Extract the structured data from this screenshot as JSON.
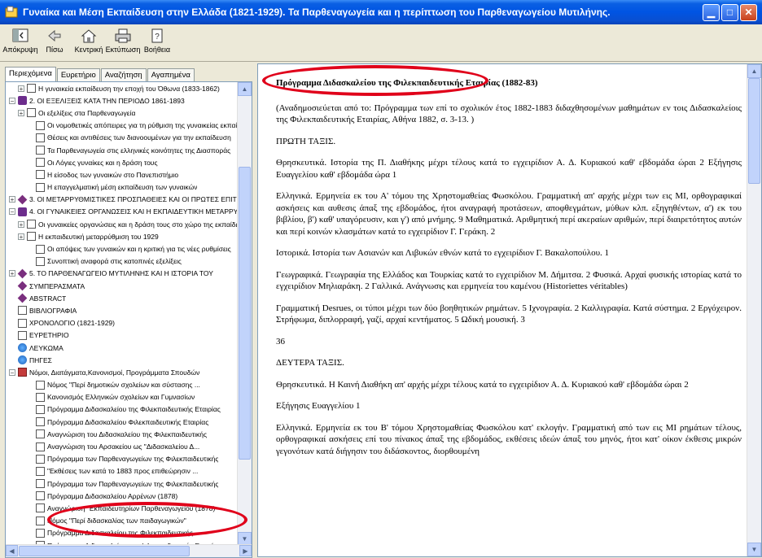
{
  "window": {
    "title": "Γυναίκα και Μέση Εκπαίδευση στην Ελλάδα (1821-1929). Τα Παρθεναγωγεία και η περίπτωση του Παρθεναγωγείου Μυτιλήνης.",
    "minimize": "▁",
    "maximize": "□",
    "close": "✕"
  },
  "toolbar": {
    "hide": "Απόκρυψη",
    "back": "Πίσω",
    "home": "Κεντρική",
    "print": "Εκτύπωση",
    "help": "Βοήθεια"
  },
  "tabs": [
    {
      "label": "Περιεχόμενα",
      "active": true
    },
    {
      "label": "Ευρετήριο",
      "active": false
    },
    {
      "label": "Αναζήτηση",
      "active": false
    },
    {
      "label": "Αγαπημένα",
      "active": false
    }
  ],
  "tree": [
    {
      "indent": 1,
      "exp": "+",
      "icon": "page",
      "label": "Η γυναικεία εκπαίδευση την εποχή του Όθωνα (1833-1862)"
    },
    {
      "indent": 0,
      "exp": "−",
      "icon": "book",
      "label": "2. ΟΙ ΕΞΕΛΙΞΕΙΣ ΚΑΤΑ ΤΗΝ ΠΕΡΙΟΔΟ 1861-1893"
    },
    {
      "indent": 1,
      "exp": "+",
      "icon": "page",
      "label": "Οι εξελίξεις στα Παρθεναγωγεία"
    },
    {
      "indent": 2,
      "exp": "",
      "icon": "page",
      "label": "Οι νομοθετικές απόπειρες για τη ρύθμιση της γυναικείας εκπαίδευσης"
    },
    {
      "indent": 2,
      "exp": "",
      "icon": "page",
      "label": "Θέσεις και αντιθέσεις των διανοουμένων για την εκπαίδευση"
    },
    {
      "indent": 2,
      "exp": "",
      "icon": "page",
      "label": "Τα Παρθεναγωγεία στις ελληνικές κοινότητες της Διασποράς"
    },
    {
      "indent": 2,
      "exp": "",
      "icon": "page",
      "label": "Οι Λόγιες γυναίκες και η δράση τους"
    },
    {
      "indent": 2,
      "exp": "",
      "icon": "page",
      "label": "Η είσοδος των γυναικών στο Πανεπιστήμιο"
    },
    {
      "indent": 2,
      "exp": "",
      "icon": "page",
      "label": "Η επαγγελματική μέση εκπαίδευση των γυναικών"
    },
    {
      "indent": 0,
      "exp": "+",
      "icon": "gem",
      "label": "3. ΟΙ ΜΕΤΑΡΡΥΘΜΙΣΤΙΚΕΣ ΠΡΟΣΠΑΘΕΙΕΣ ΚΑΙ ΟΙ ΠΡΩΤΕΣ ΕΠΙΤΥΧΙΕΣ"
    },
    {
      "indent": 0,
      "exp": "−",
      "icon": "book",
      "label": "4. ΟΙ ΓΥΝΑΙΚΕΙΕΣ ΟΡΓΑΝΩΣΕΙΣ ΚΑΙ Η ΕΚΠΑΙΔΕΥΤΙΚΗ ΜΕΤΑΡΡΥΘΜΙΣΗ"
    },
    {
      "indent": 1,
      "exp": "+",
      "icon": "page",
      "label": "Οι γυναικείες οργανώσεις και η δράση τους στο χώρο της εκπαίδευσης"
    },
    {
      "indent": 1,
      "exp": "+",
      "icon": "page",
      "label": "Η εκπαιδευτική μεταρρύθμιση του 1929"
    },
    {
      "indent": 2,
      "exp": "",
      "icon": "page",
      "label": "Οι απόψεις των γυναικών και η κριτική για τις νέες ρυθμίσεις"
    },
    {
      "indent": 2,
      "exp": "",
      "icon": "page",
      "label": "Συνοπτική αναφορά στις κατοπινές εξελίξεις"
    },
    {
      "indent": 0,
      "exp": "+",
      "icon": "gem",
      "label": "5. ΤΟ ΠΑΡΘΕΝΑΓΩΓΕΙΟ ΜΥΤΙΛΗΝΗΣ ΚΑΙ Η ΙΣΤΟΡΙΑ ΤΟΥ"
    },
    {
      "indent": 0,
      "exp": "",
      "icon": "gem",
      "label": "ΣΥΜΠΕΡΑΣΜΑΤΑ"
    },
    {
      "indent": 0,
      "exp": "",
      "icon": "gem",
      "label": "ABSTRACT"
    },
    {
      "indent": 0,
      "exp": "",
      "icon": "page",
      "label": "ΒΙΒΛΙΟΓΡΑΦΙΑ"
    },
    {
      "indent": 0,
      "exp": "",
      "icon": "page",
      "label": "ΧΡΟΝΟΛΟΓΙΟ (1821-1929)"
    },
    {
      "indent": 0,
      "exp": "",
      "icon": "page",
      "label": "ΕΥΡΕΤΗΡΙΟ"
    },
    {
      "indent": 0,
      "exp": "",
      "icon": "globe",
      "label": "ΛΕΥΚΩΜΑ"
    },
    {
      "indent": 0,
      "exp": "",
      "icon": "globe",
      "label": "ΠΗΓΕΣ"
    },
    {
      "indent": 0,
      "exp": "−",
      "icon": "redbook",
      "label": "Νόμοι, Διατάγματα,Κανονισμοί, Προγράμματα Σπουδών"
    },
    {
      "indent": 2,
      "exp": "",
      "icon": "page",
      "label": "Νόμος \"Περί δημοτικών σχολείων και σύστασης ..."
    },
    {
      "indent": 2,
      "exp": "",
      "icon": "page",
      "label": "Κανονισμός Ελληνικών σχολείων και Γυμνασίων"
    },
    {
      "indent": 2,
      "exp": "",
      "icon": "page",
      "label": "Πρόγραμμα Διδασκαλείου της Φιλεκπαιδευτικής Εταιρίας"
    },
    {
      "indent": 2,
      "exp": "",
      "icon": "page",
      "label": "Πρόγραμμα Διδασκαλείου Φιλεκπαιδευτικής Εταιρίας"
    },
    {
      "indent": 2,
      "exp": "",
      "icon": "page",
      "label": "Αναγνώριση του Διδασκαλείου της Φιλεκπαιδευτικής"
    },
    {
      "indent": 2,
      "exp": "",
      "icon": "page",
      "label": "Αναγνώριση του Αρσακείου ως \"Διδασκαλείου Δ..."
    },
    {
      "indent": 2,
      "exp": "",
      "icon": "page",
      "label": "Πρόγραμμα των Παρθεναγωγείων της Φιλεκπαιδευτικής"
    },
    {
      "indent": 2,
      "exp": "",
      "icon": "page",
      "label": "\"Εκθέσεις των κατά το 1883 προς επιθεώρησιν ..."
    },
    {
      "indent": 2,
      "exp": "",
      "icon": "page",
      "label": "Πρόγραμμα των Παρθεναγωγείων της Φιλεκπαιδευτικής"
    },
    {
      "indent": 2,
      "exp": "",
      "icon": "page",
      "label": "Πρόγραμμα Διδασκαλείου Αρρένων (1878)"
    },
    {
      "indent": 2,
      "exp": "",
      "icon": "page",
      "label": "Αναγνώριση \"Εκπαιδευτηρίων Παρθεναγωγείου (1878)"
    },
    {
      "indent": 2,
      "exp": "",
      "icon": "page",
      "label": "Νόμος \"Περί διδασκαλίας των παιδαγωγικών\""
    },
    {
      "indent": 2,
      "exp": "",
      "icon": "page",
      "label": "Πρόγραμμα Διδασκαλείου της Φιλεκπαιδευτικής"
    },
    {
      "indent": 2,
      "exp": "",
      "icon": "page",
      "label": "Πρόγραμμα Διδασκαλείου της Φιλεκπαιδευτικής Εταιρίας"
    }
  ],
  "document": {
    "heading": "Πρόγραμμα Διδασκαλείου της Φιλεκπαιδευτικής Εταιρίας (1882-83)",
    "paragraphs": [
      "(Αναδημοσιεύεται από το: Πρόγραμμα των επί το σχολικόν έτος 1882-1883 διδαχθησομένων μαθημάτων εν τοις Διδασκαλείοις της Φιλεκπαιδευτικής Εταιρίας, Αθήνα 1882, σ. 3-13. )",
      "ΠΡΩΤΗ ΤΑΞΙΣ.",
      "Θρησκευτικά. Ιστορία της Π. Διαθήκης μέχρι τέλους κατά το εγχειρίδιον Α. Δ. Κυριακού καθ' εβδομάδα ώραι 2 Εξήγησις Ευαγγελίου καθ' εβδομάδα ώρα 1",
      "Ελληνικά. Ερμηνεία εκ του Α' τόμου της Χρηστομαθείας Φωσκόλου. Γραμματική απ' αρχής μέχρι των εις ΜΙ, ορθογραφικαί ασκήσεις και αυθεσις άπαξ της εβδομάδος, ήτοι αναγραφή προτάσεων, αποφθεγμάτων, μύθων κλπ. εξηγηθέντων, α') εκ του βιβλίου, β') καθ' υπαγόρευσιν, και γ') από μνήμης. 9 Μαθηματικά. Αριθμητική περί ακεραίων αριθμών, περί διαιρετότητος αυτών και περί κοινών κλασμάτων κατά το εγχειρίδιον Γ. Γεράκη. 2",
      "Ιστορικά. Ιστορία των Ασιανών και Λιβυκών εθνών κατά το εγχειρίδιον Γ. Βακαλοπούλου. 1",
      "Γεωγραφικά. Γεωγραφία της Ελλάδος και Τουρκίας κατά το εγχειρίδιον Μ. Δήμιτσα. 2 Φυσικά. Αρχαί φυσικής ιστορίας κατά το εγχειρίδιον Μηλιαράκη. 2 Γαλλικά. Ανάγνωσις και ερμηνεία του καμένου (Historiettes véritables)",
      "Γραμματική Desrues, οι τύποι μέχρι των δύο βοηθητικών ρημάτων. 5 Ιχνογραφία. 2 Καλλιγραφία. Κατά σύστημα. 2 Εργόχειρον. Στρήφωμα, διπλορραφή, γαζί, αρχαί κεντήματος. 5 Ωδική μουσική. 3",
      "36",
      "ΔΕΥΤΕΡΑ ΤΑΞΙΣ.",
      "Θρησκευτικά. Η Καινή Διαθήκη απ' αρχής μέχρι τέλους κατά το εγχειρίδιον Α. Δ. Κυριακού καθ' εβδομάδα ώραι 2",
      "Εξήγησις Ευαγγελίου 1",
      "Ελληνικά. Ερμηνεία εκ του Β' τόμου Χρηστομαθείας Φωσκόλου κατ' εκλογήν. Γραμματική από των εις ΜΙ ρημάτων τέλους, ορθογραφικαί ασκήσεις επί του πίνακος άπαξ της εβδομάδος, εκθέσεις ιδεών άπαξ του μηνός, ήτοι κατ' οίκον έκθεσις μικρών γεγονότων κατά διήγησιν του διδάσκοντος, διορθουμένη"
    ]
  },
  "colors": {
    "titlebar": "#0054e3",
    "annotation": "#e0001a",
    "panel": "#ece9d8"
  }
}
